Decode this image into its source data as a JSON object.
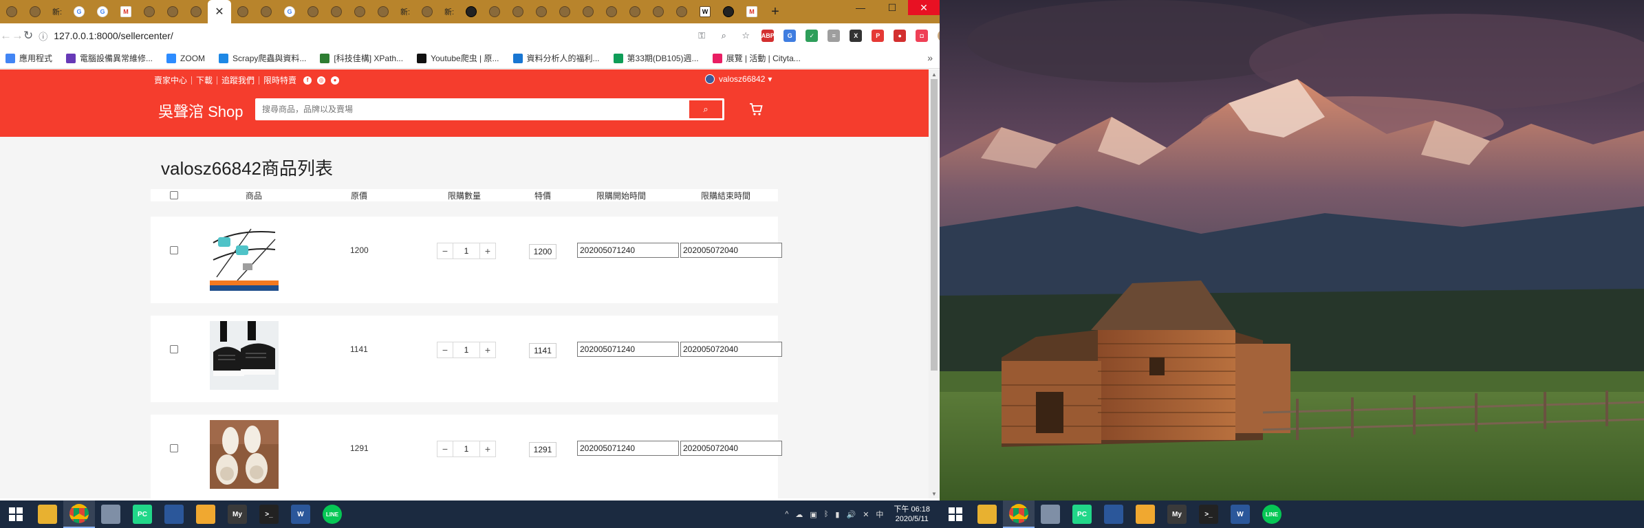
{
  "browser": {
    "tabs": [
      {
        "icon": "chrome-icon",
        "glyph": ""
      },
      {
        "icon": "chrome-icon",
        "glyph": ""
      },
      {
        "icon": "text",
        "glyph": "新:"
      },
      {
        "icon": "google-icon",
        "glyph": "G"
      },
      {
        "icon": "google-icon",
        "glyph": "G"
      },
      {
        "icon": "gmail-icon",
        "glyph": "M"
      },
      {
        "icon": "chrome-icon",
        "glyph": ""
      },
      {
        "icon": "chrome-icon",
        "glyph": ""
      },
      {
        "icon": "chrome-icon",
        "glyph": ""
      },
      {
        "icon": "active",
        "glyph": "✕"
      },
      {
        "icon": "chrome-icon",
        "glyph": ""
      },
      {
        "icon": "chrome-icon",
        "glyph": ""
      },
      {
        "icon": "google-icon",
        "glyph": "G"
      },
      {
        "icon": "chrome-icon",
        "glyph": ""
      },
      {
        "icon": "chrome-icon",
        "glyph": ""
      },
      {
        "icon": "chrome-icon",
        "glyph": ""
      },
      {
        "icon": "chrome-icon",
        "glyph": ""
      },
      {
        "icon": "text",
        "glyph": "新:"
      },
      {
        "icon": "chrome-icon",
        "glyph": ""
      },
      {
        "icon": "text",
        "glyph": "新:"
      },
      {
        "icon": "github-icon",
        "glyph": ""
      },
      {
        "icon": "chrome-icon",
        "glyph": ""
      },
      {
        "icon": "chrome-icon",
        "glyph": ""
      },
      {
        "icon": "chrome-icon",
        "glyph": ""
      },
      {
        "icon": "chrome-icon",
        "glyph": ""
      },
      {
        "icon": "chrome-icon",
        "glyph": ""
      },
      {
        "icon": "chrome-icon",
        "glyph": ""
      },
      {
        "icon": "chrome-icon",
        "glyph": ""
      },
      {
        "icon": "chrome-icon",
        "glyph": ""
      },
      {
        "icon": "chrome-icon",
        "glyph": ""
      },
      {
        "icon": "wikipedia-icon",
        "glyph": "W"
      },
      {
        "icon": "github-icon",
        "glyph": ""
      },
      {
        "icon": "gmail-icon",
        "glyph": "M"
      }
    ],
    "new_tab": "+",
    "window_controls": {
      "minimize": "—",
      "maximize": "☐",
      "close": "✕"
    },
    "url": "127.0.0.1:8000/sellercenter/",
    "bookmarks": [
      {
        "label": "應用程式",
        "color": "#4285f4"
      },
      {
        "label": "電腦設備異常維修...",
        "color": "#673ab7"
      },
      {
        "label": "ZOOM",
        "color": "#2d8cff"
      },
      {
        "label": "Scrapy爬蟲與資料...",
        "color": "#1e88e5"
      },
      {
        "label": "[科技佳構] XPath...",
        "color": "#2e7d32"
      },
      {
        "label": "Youtube爬虫 | 原...",
        "color": "#111111"
      },
      {
        "label": "資料分析人的福利...",
        "color": "#1976d2"
      },
      {
        "label": "第33期(DB105)週...",
        "color": "#0f9d58"
      },
      {
        "label": "展覽 | 活動 | Cityta...",
        "color": "#e91e63"
      }
    ],
    "bookmarks_more": "»"
  },
  "shop": {
    "topnav": [
      "賣家中心",
      "下載",
      "追蹤我們",
      "限時特賣"
    ],
    "social": [
      "f",
      "◎",
      "●"
    ],
    "username": "valosz66842",
    "user_caret": "▾",
    "brand": "吳聲涫 Shop",
    "search_placeholder": "搜尋商品，品牌以及賣場",
    "search_icon": "⌕",
    "cart_icon": "🛒",
    "page_title": "valosz66842商品列表",
    "table_headers": {
      "product": "商品",
      "price": "原價",
      "quantity": "限購數量",
      "deal_price": "特價",
      "start": "限購開始時間",
      "end": "限購結束時間"
    },
    "rows": [
      {
        "price": "1200",
        "qty": "1",
        "deal_price": "1200",
        "start": "202005071240",
        "end": "202005072040",
        "image": "usb-cables"
      },
      {
        "price": "1141",
        "qty": "1",
        "deal_price": "1141",
        "start": "202005071240",
        "end": "202005072040",
        "image": "sneakers"
      },
      {
        "price": "1291",
        "qty": "1",
        "deal_price": "1291",
        "start": "202005071240",
        "end": "202005072040",
        "image": "slippers"
      }
    ],
    "stepper": {
      "minus": "−",
      "plus": "+"
    }
  },
  "taskbar": {
    "apps": [
      {
        "name": "file-explorer-icon",
        "color": "#e8b130",
        "glyph": ""
      },
      {
        "name": "chrome-icon",
        "color": "#ffffff",
        "glyph": ""
      },
      {
        "name": "remote-desktop-icon",
        "color": "#7f8fa6",
        "glyph": ""
      },
      {
        "name": "pycharm-icon",
        "color": "#21d789",
        "glyph": "PC"
      },
      {
        "name": "paint-icon",
        "color": "#2b579a",
        "glyph": ""
      },
      {
        "name": "snipping-icon",
        "color": "#f0a830",
        "glyph": ""
      },
      {
        "name": "mysql-workbench-icon",
        "color": "#3a3a3a",
        "glyph": "My"
      },
      {
        "name": "terminal-icon",
        "color": "#222222",
        "glyph": ">_"
      },
      {
        "name": "word-icon",
        "color": "#2b579a",
        "glyph": "W"
      },
      {
        "name": "line-icon",
        "color": "#06c755",
        "glyph": "LINE"
      }
    ],
    "tray": [
      "^",
      "☁",
      "▣",
      "ᛒ",
      "▮",
      "🔊",
      "✕",
      "中"
    ],
    "clock_time": "下午 06:18",
    "clock_date": "2020/5/11"
  }
}
